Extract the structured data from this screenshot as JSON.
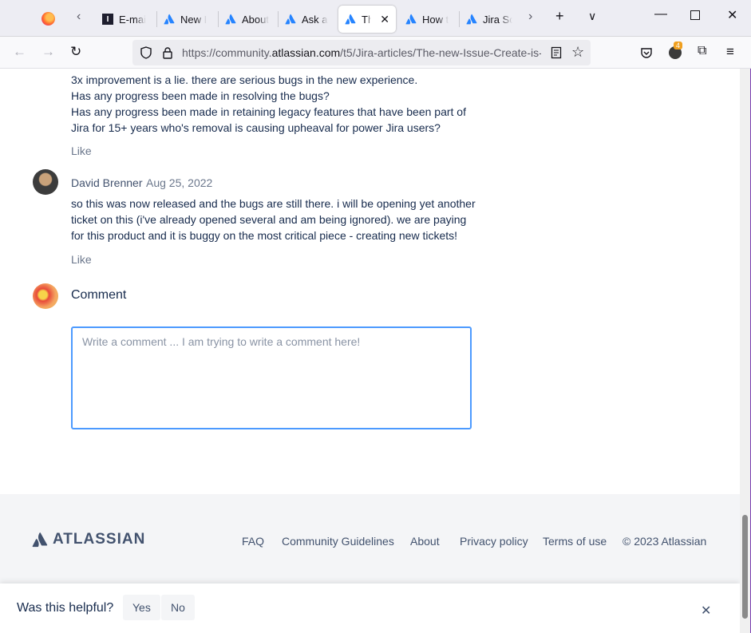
{
  "browser": {
    "tabs": [
      {
        "label": "E-mai",
        "favicon": "i-icon"
      },
      {
        "label": "New I",
        "favicon": "atlassian-icon"
      },
      {
        "label": "About",
        "favicon": "atlassian-icon"
      },
      {
        "label": "Ask a",
        "favicon": "atlassian-icon"
      },
      {
        "label": "The",
        "favicon": "atlassian-icon",
        "active": true
      },
      {
        "label": "How t",
        "favicon": "atlassian-icon"
      },
      {
        "label": "Jira Sc",
        "favicon": "atlassian-icon"
      }
    ],
    "url_prefix": "https://community.",
    "url_host": "atlassian.com",
    "url_path": "/t5/Jira-articles/The-new-Issue-Create-is-",
    "extension_badge": "4"
  },
  "thread": {
    "prev_comment_lines": [
      "3x improvement is a lie.  there are serious bugs in the new experience.",
      "Has any progress been made in resolving the bugs?",
      "Has any progress been made in retaining legacy features that have been part of",
      "Jira for 15+ years who's removal is causing upheaval for power Jira users?"
    ],
    "like_label": "Like",
    "reply": {
      "author": "David Brenner",
      "date": "Aug 25, 2022",
      "lines": [
        "so this was now released and the bugs are still there.  i will be opening yet another",
        "ticket on this (i've already opened several and am being ignored).  we are paying",
        "for this product and it is buggy on the most critical piece - creating new tickets!"
      ]
    },
    "comment_heading": "Comment",
    "comment_value": "Write a comment ... I am trying to write a comment here!"
  },
  "footer": {
    "logo_text": "ATLASSIAN",
    "links": [
      "FAQ",
      "Community Guidelines",
      "About",
      "Privacy policy",
      "Terms of use"
    ],
    "copyright": "© 2023 Atlassian"
  },
  "helpful": {
    "question": "Was this helpful?",
    "yes": "Yes",
    "no": "No"
  },
  "colors": {
    "accent": "#4c9aff",
    "atlassian_blue": "#2684ff",
    "text": "#172b4d"
  }
}
